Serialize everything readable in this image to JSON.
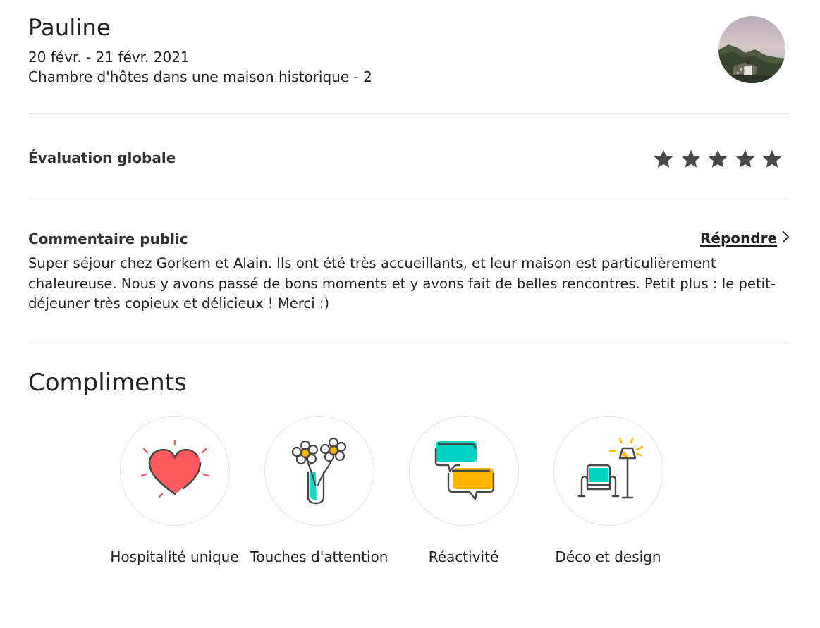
{
  "review": {
    "reviewer_name": "Pauline",
    "dates": "20 févr. - 21 févr. 2021",
    "listing": "Chambre d'hôtes dans une maison historique - 2"
  },
  "rating": {
    "label": "Évaluation globale",
    "stars": 5,
    "star_color": "#484848"
  },
  "public_comment": {
    "label": "Commentaire public",
    "reply_label": "Répondre",
    "text": "Super séjour chez Gorkem et Alain. Ils ont été très accueillants, et leur maison est particulièrement chaleureuse. Nous y avons passé de bons moments et y avons fait de belles rencontres. Petit plus : le petit-déjeuner très copieux et délicieux ! Merci :)"
  },
  "compliments": {
    "title": "Compliments",
    "items": [
      {
        "label": "Hospitalité unique",
        "icon": "heart-icon"
      },
      {
        "label": "Touches d'attention",
        "icon": "flowers-vase-icon"
      },
      {
        "label": "Réactivité",
        "icon": "chat-bubbles-icon"
      },
      {
        "label": "Déco et design",
        "icon": "armchair-lamp-icon"
      }
    ]
  },
  "colors": {
    "heart_red": "#ff5a5f",
    "teal": "#00d1c1",
    "yellow": "#ffb400",
    "line_dark": "#484848",
    "divider": "#e4e4e4"
  }
}
